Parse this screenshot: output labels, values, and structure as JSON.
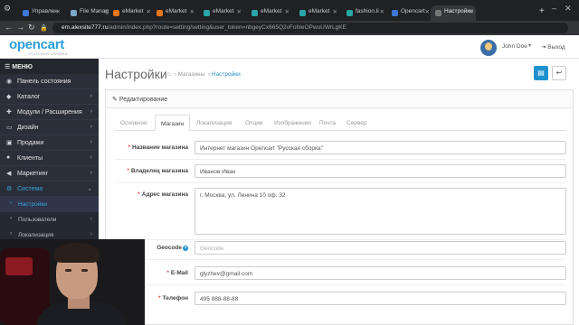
{
  "browser": {
    "tabs": [
      {
        "label": "Управлен",
        "color": "#3c78d8"
      },
      {
        "label": "File Manag",
        "color": "#7aa8c8"
      },
      {
        "label": "eMarket",
        "color": "#e8751a"
      },
      {
        "label": "eMarket",
        "color": "#e8751a"
      },
      {
        "label": "eMarket",
        "color": "#27a6a6"
      },
      {
        "label": "eMarket",
        "color": "#27a6a6"
      },
      {
        "label": "eMarket",
        "color": "#27a6a6"
      },
      {
        "label": "fashion.li",
        "color": "#27a6a6"
      },
      {
        "label": "Opencart",
        "color": "#3c78d8"
      },
      {
        "label": "Настройки",
        "color": "#777777"
      }
    ],
    "url_host": "em.alexsite777.ru",
    "url_path": "/admin/index.php?route=setting/setting&user_token=nbgeyCx665Q2vFohIeOPwuUWrLgKE",
    "new_tab": "+"
  },
  "header": {
    "logo": "opencart",
    "logo_sub": "РУССКАЯ СБОРКА",
    "user_name": "John Doe",
    "user_caret": "▾",
    "logout": "Выход"
  },
  "sidebar": {
    "menu_title": "МЕНЮ",
    "items": [
      {
        "label": "Панель состояния",
        "icon": "◉",
        "chev": ""
      },
      {
        "label": "Каталог",
        "icon": "◆",
        "chev": "›"
      },
      {
        "label": "Модули / Расширения",
        "icon": "✚",
        "chev": "›"
      },
      {
        "label": "Дизайн",
        "icon": "▭",
        "chev": "›"
      },
      {
        "label": "Продажи",
        "icon": "▣",
        "chev": "›"
      },
      {
        "label": "Клиенты",
        "icon": "●",
        "chev": "›"
      },
      {
        "label": "Маркетинг",
        "icon": "◀",
        "chev": "›"
      },
      {
        "label": "Система",
        "icon": "⚙",
        "chev": "⌄"
      }
    ],
    "subitems": [
      {
        "label": "Настройки",
        "chev": ""
      },
      {
        "label": "Пользователи",
        "chev": "›"
      },
      {
        "label": "Локализация",
        "chev": "›"
      }
    ]
  },
  "main": {
    "title": "Настройки",
    "breadcrumb": [
      "Магазины",
      "Настройки"
    ],
    "panel_title": "Редактирование",
    "tabs": [
      "Основное",
      "Магазин",
      "Локализация",
      "Опции",
      "Изображения",
      "Почта",
      "Сервер"
    ],
    "fields": [
      {
        "label": "Название магазина",
        "required": true,
        "value": "Интернет магазин Opencart \"Русская сборка\"",
        "placeholder": false
      },
      {
        "label": "Владелец магазина",
        "required": true,
        "value": "Иванов Иван",
        "placeholder": false
      },
      {
        "label": "Адрес магазина",
        "required": true,
        "value": "г. Москва, ул. Ленина 10 оф. 32",
        "placeholder": false
      },
      {
        "label": "Geocode",
        "required": false,
        "value": "Geocode",
        "placeholder": true
      },
      {
        "label": "E-Mail",
        "required": true,
        "value": "glyzhev@gmail.com",
        "placeholder": false
      },
      {
        "label": "Телефон",
        "required": true,
        "value": "495 888-88-88",
        "placeholder": false
      }
    ]
  }
}
